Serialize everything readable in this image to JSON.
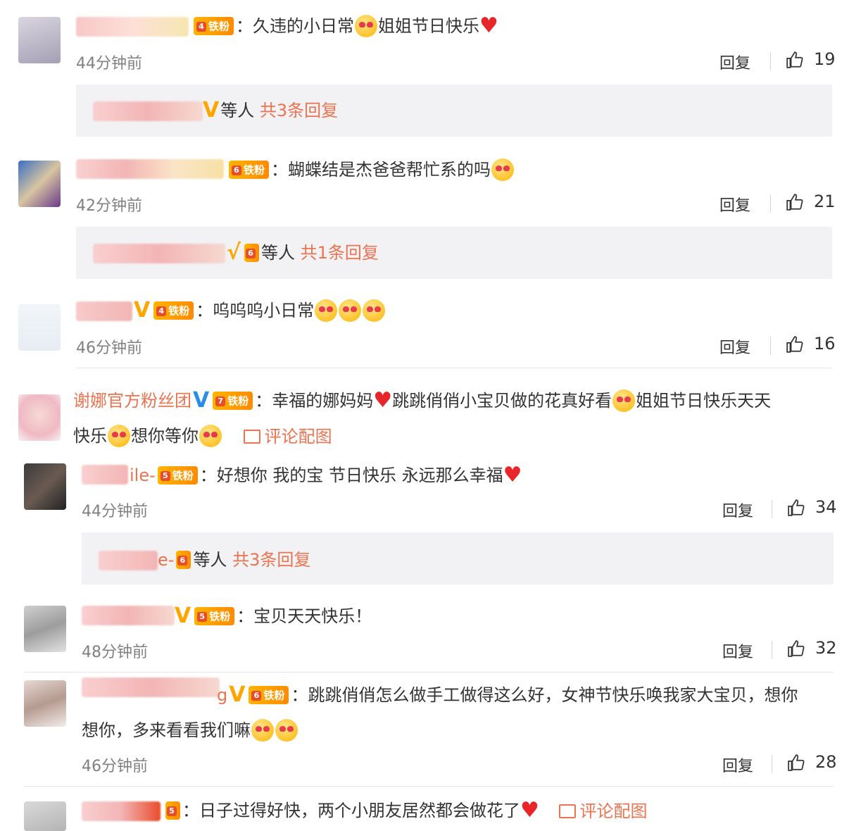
{
  "fan_badge": "铁粉",
  "reply_label": "回复",
  "comments": [
    {
      "text": "：久违的小日常",
      "text2": "姐姐节日快乐",
      "time": "44分钟前",
      "likes": "19"
    },
    {
      "text": "：蝴蝶结是杰爸爸帮忙系的吗",
      "time": "42分钟前",
      "likes": "21"
    },
    {
      "text": "：呜呜呜小日常",
      "time": "46分钟前",
      "likes": "16"
    },
    {
      "nick": "谢娜官方粉丝团",
      "text": "：幸福的娜妈妈",
      "text2": "跳跳俏俏小宝贝做的花真好看",
      "text3": "姐姐节日快乐天天",
      "text4": "快乐",
      "text5": "想你等你",
      "config": "评论配图"
    },
    {
      "nick_tail": "ile-",
      "text": "：好想你 我的宝 节日快乐 永远那么幸福",
      "time": "44分钟前",
      "likes": "34"
    },
    {
      "text": "：宝贝天天快乐！",
      "time": "48分钟前",
      "likes": "32"
    },
    {
      "nick_tail": "g",
      "text": "：跳跳俏俏怎么做手工做得这么好，女神节快乐唤我家大宝贝，想你",
      "text2": "想你，多来看看我们嘛",
      "time": "46分钟前",
      "likes": "28"
    },
    {
      "text": "：日子过得好快，两个小朋友居然都会做花了",
      "config": "评论配图"
    }
  ],
  "reply_boxes": [
    {
      "text": "等人",
      "count": "共3条回复"
    },
    {
      "text": "等人",
      "count": "共1条回复"
    },
    {
      "nick_tail": "e-",
      "text": "等人",
      "count": "共3条回复"
    }
  ],
  "icons": [
    "thumbs-up-icon",
    "heart-icon",
    "smile-emoji-icon",
    "image-icon",
    "verified-v-icon"
  ],
  "colors": {
    "accent": "#eb7350",
    "badge": "#ff9a00",
    "reply_bg": "#f2f2f5"
  }
}
